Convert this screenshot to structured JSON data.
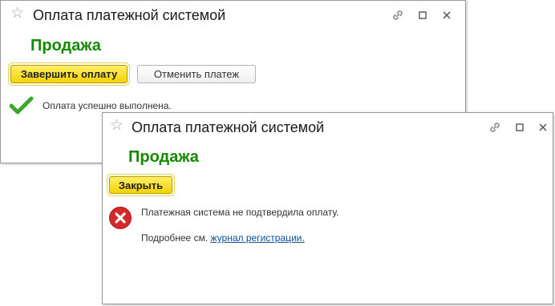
{
  "window_back": {
    "title": "Оплата платежной системой",
    "heading": "Продажа",
    "finish_button": "Завершить оплату",
    "cancel_button": "Отменить платеж",
    "status_message": "Оплата успешно выполнена."
  },
  "window_front": {
    "title": "Оплата платежной системой",
    "heading": "Продажа",
    "close_button": "Закрыть",
    "error_message": "Платежная система не подтвердила оплату.",
    "details_prefix": "Подробнее см.",
    "details_link": "журнал регистрации."
  },
  "icons": {
    "favorite": "star-icon",
    "link": "link-icon",
    "maximize": "maximize-icon",
    "close": "close-icon",
    "success": "checkmark-icon",
    "error": "error-icon"
  },
  "colors": {
    "heading": "#148a00",
    "primary_button": "#f5d300",
    "link": "#0e4d9a",
    "success": "#3aa829",
    "error": "#d62828"
  }
}
